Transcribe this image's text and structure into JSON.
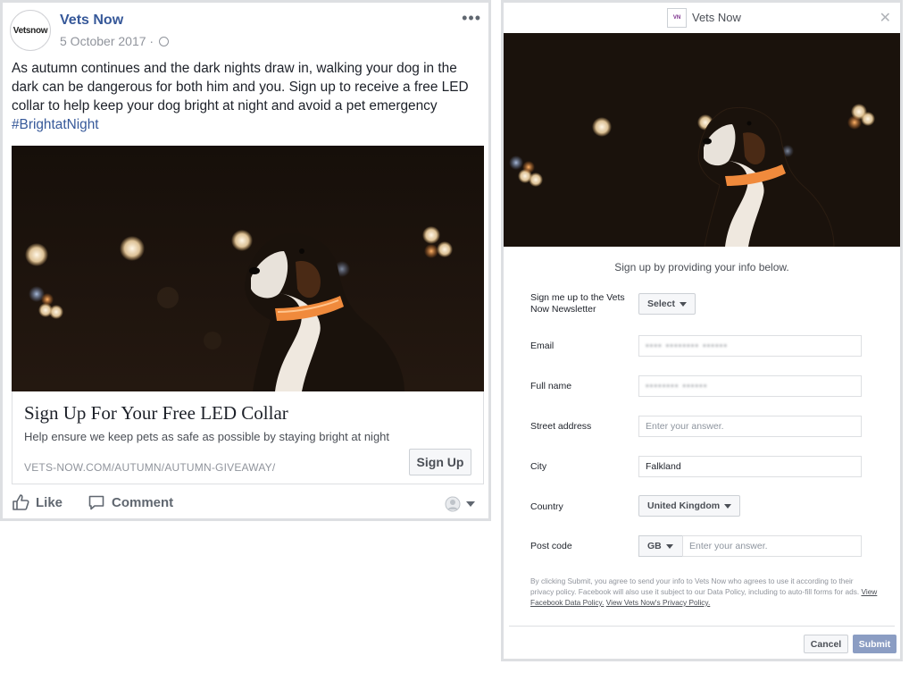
{
  "post": {
    "page_name": "Vets Now",
    "avatar_text": "Vetsnow",
    "date": "5 October 2017 ·",
    "body": "As autumn continues and the dark nights draw in, walking your dog in the dark can be dangerous for both him and you. Sign up to receive a free LED collar to help keep your dog bright at night and avoid a pet emergency",
    "hashtag": "#BrightatNight",
    "link_card": {
      "title": "Sign Up For Your Free LED Collar",
      "description": "Help ensure we keep pets as safe as possible by staying bright at night",
      "url": "VETS-NOW.COM/AUTUMN/AUTUMN-GIVEAWAY/",
      "button": "Sign Up"
    },
    "actions": {
      "like": "Like",
      "comment": "Comment"
    }
  },
  "form": {
    "brand": "Vets Now",
    "intro": "Sign up by providing your info below.",
    "fields": {
      "newsletter": {
        "label": "Sign me up to the Vets Now Newsletter",
        "value": "Select"
      },
      "email": {
        "label": "Email",
        "value": "•••• •••••••• ••••••"
      },
      "full_name": {
        "label": "Full name",
        "value": "•••••••• ••••••"
      },
      "street": {
        "label": "Street address",
        "placeholder": "Enter your answer."
      },
      "city": {
        "label": "City",
        "value": "Falkland"
      },
      "country": {
        "label": "Country",
        "value": "United Kingdom"
      },
      "postcode": {
        "label": "Post code",
        "country_code": "GB",
        "placeholder": "Enter your answer."
      }
    },
    "disclaimer": "By clicking Submit, you agree to send your info to Vets Now who agrees to use it according to their privacy policy. Facebook will also use it subject to our Data Policy, including to auto-fill forms for ads.",
    "link_fb_policy": "View Facebook Data Policy.",
    "link_vn_policy": "View Vets Now's Privacy Policy.",
    "cancel": "Cancel",
    "submit": "Submit"
  },
  "colors": {
    "link_blue": "#365899",
    "submit_disabled": "#8b9dc3",
    "collar_orange": "#f08a3c",
    "night_bg": "#1c140d"
  }
}
